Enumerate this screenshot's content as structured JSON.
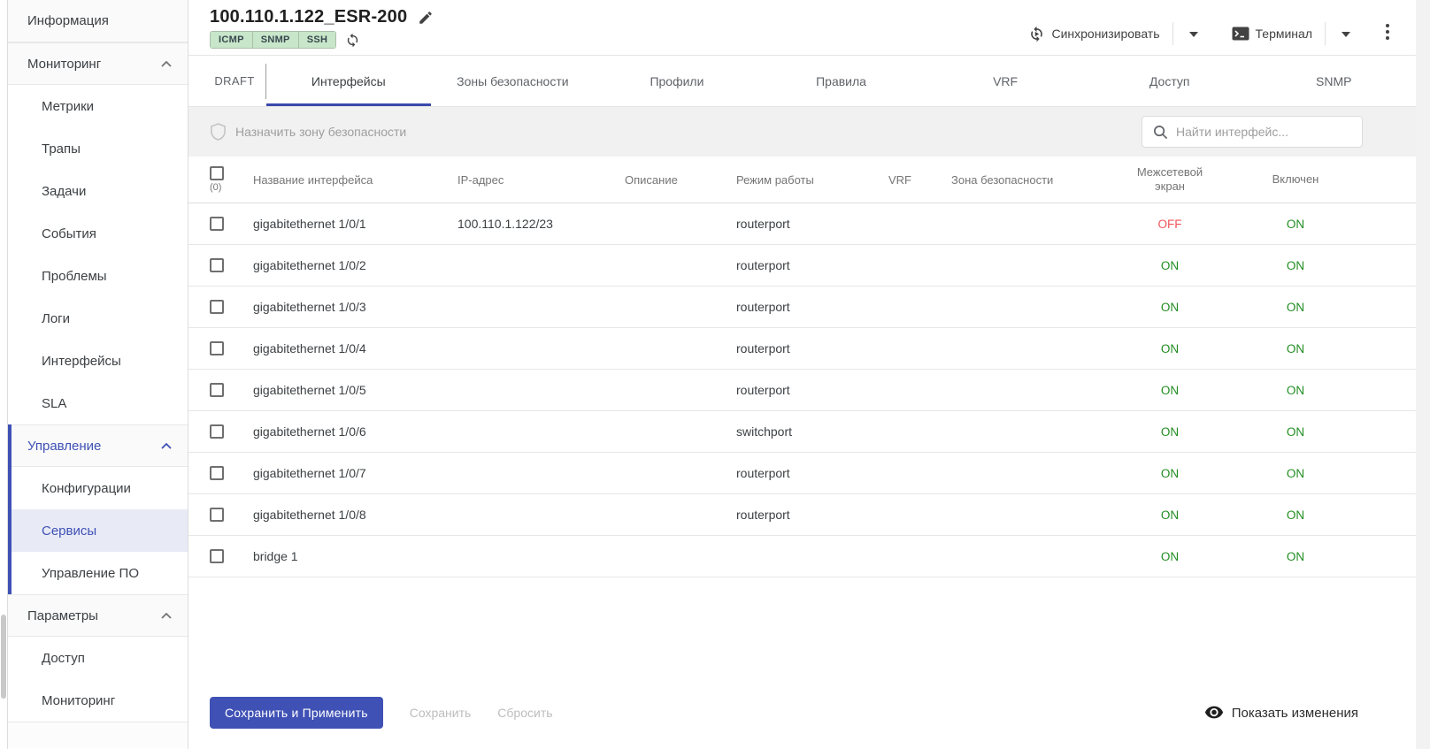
{
  "colors": {
    "accent": "#3f51b5",
    "tab_underline": "#3949ab",
    "on_green": "#218c21",
    "off_red": "#f2545b",
    "badge_bg": "#c8e6c9"
  },
  "sidebar": {
    "items": [
      "Информация",
      "Мониторинг",
      "Метрики",
      "Трапы",
      "Задачи",
      "События",
      "Проблемы",
      "Логи",
      "Интерфейсы",
      "SLA",
      "Управление",
      "Конфигурации",
      "Сервисы",
      "Управление ПО",
      "Параметры",
      "Доступ",
      "Мониторинг"
    ]
  },
  "header": {
    "title": "100.110.1.122_ESR-200",
    "badges": [
      "ICMP",
      "SNMP",
      "SSH"
    ],
    "sync_label": "Синхронизировать",
    "terminal_label": "Терминал"
  },
  "tabs": {
    "draft": "DRAFT",
    "labels": [
      "Интерфейсы",
      "Зоны безопасности",
      "Профили",
      "Правила",
      "VRF",
      "Доступ",
      "SNMP"
    ],
    "active": "Интерфейсы"
  },
  "toolbar": {
    "assign_zone_label": "Назначить зону безопасности",
    "search_placeholder": "Найти интерфейс..."
  },
  "table": {
    "selected_count": "(0)",
    "columns": [
      "Название интерфейса",
      "IP-адрес",
      "Описание",
      "Режим работы",
      "VRF",
      "Зона безопасности",
      "Межсетевой экран",
      "Включен"
    ],
    "rows": [
      {
        "name": "gigabitethernet 1/0/1",
        "ip": "100.110.1.122/23",
        "description": "",
        "mode": "routerport",
        "vrf": "",
        "zone": "",
        "firewall": "OFF",
        "enabled": "ON"
      },
      {
        "name": "gigabitethernet 1/0/2",
        "ip": "",
        "description": "",
        "mode": "routerport",
        "vrf": "",
        "zone": "",
        "firewall": "ON",
        "enabled": "ON"
      },
      {
        "name": "gigabitethernet 1/0/3",
        "ip": "",
        "description": "",
        "mode": "routerport",
        "vrf": "",
        "zone": "",
        "firewall": "ON",
        "enabled": "ON"
      },
      {
        "name": "gigabitethernet 1/0/4",
        "ip": "",
        "description": "",
        "mode": "routerport",
        "vrf": "",
        "zone": "",
        "firewall": "ON",
        "enabled": "ON"
      },
      {
        "name": "gigabitethernet 1/0/5",
        "ip": "",
        "description": "",
        "mode": "routerport",
        "vrf": "",
        "zone": "",
        "firewall": "ON",
        "enabled": "ON"
      },
      {
        "name": "gigabitethernet 1/0/6",
        "ip": "",
        "description": "",
        "mode": "switchport",
        "vrf": "",
        "zone": "",
        "firewall": "ON",
        "enabled": "ON"
      },
      {
        "name": "gigabitethernet 1/0/7",
        "ip": "",
        "description": "",
        "mode": "routerport",
        "vrf": "",
        "zone": "",
        "firewall": "ON",
        "enabled": "ON"
      },
      {
        "name": "gigabitethernet 1/0/8",
        "ip": "",
        "description": "",
        "mode": "routerport",
        "vrf": "",
        "zone": "",
        "firewall": "ON",
        "enabled": "ON"
      },
      {
        "name": "bridge 1",
        "ip": "",
        "description": "",
        "mode": "",
        "vrf": "",
        "zone": "",
        "firewall": "ON",
        "enabled": "ON"
      }
    ]
  },
  "footer": {
    "save_apply_label": "Сохранить и Применить",
    "save_label": "Сохранить",
    "reset_label": "Сбросить",
    "show_changes_label": "Показать изменения"
  }
}
